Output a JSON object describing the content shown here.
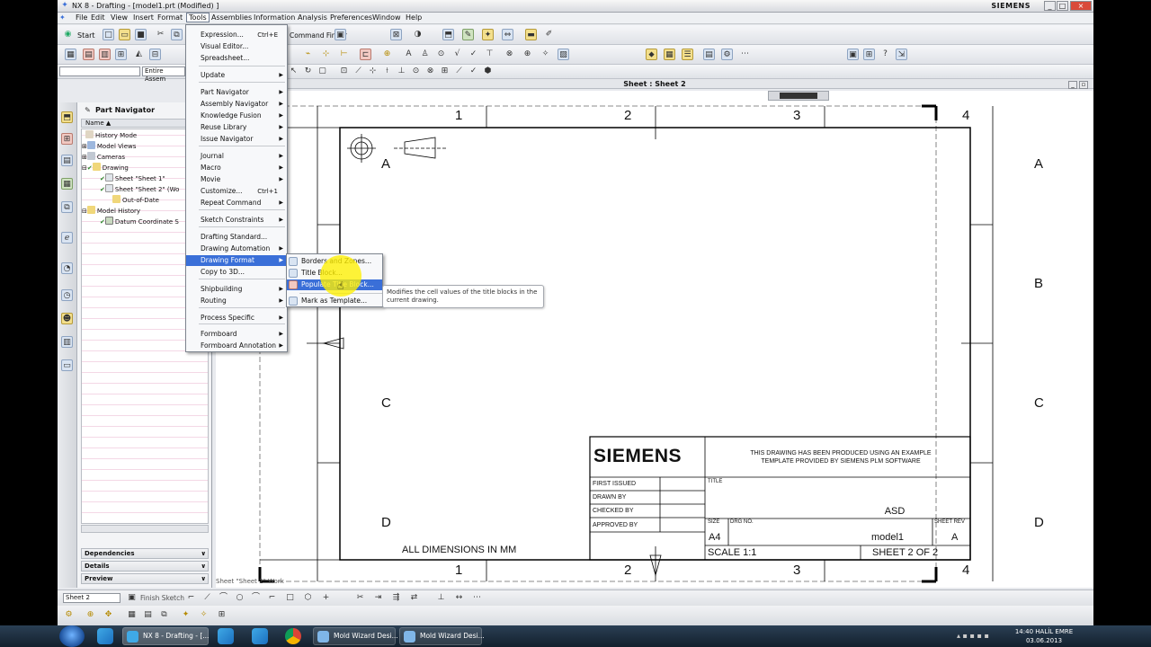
{
  "window": {
    "title": "NX 8 - Drafting - [model1.prt (Modified) ]",
    "brand": "SIEMENS",
    "controls": [
      "_",
      "□",
      "×"
    ]
  },
  "menubar": [
    "File",
    "Edit",
    "View",
    "Insert",
    "Format",
    "Tools",
    "Assemblies",
    "Information",
    "Analysis",
    "Preferences",
    "Window",
    "Help"
  ],
  "toolbar": {
    "start_label": "Start",
    "command_finder": "Command Finder",
    "selection_filter": "",
    "assembly_scope": "Entire Assem"
  },
  "sheet_bar": "Sheet : Sheet 2",
  "part_navigator": {
    "title": "Part Navigator",
    "column": "Name",
    "items": [
      {
        "label": "History Mode",
        "indent": 1
      },
      {
        "label": "Model Views",
        "indent": 1
      },
      {
        "label": "Cameras",
        "indent": 1
      },
      {
        "label": "Drawing",
        "indent": 1
      },
      {
        "label": "Sheet \"Sheet 1\"",
        "indent": 2
      },
      {
        "label": "Sheet \"Sheet 2\" (Wo",
        "indent": 2
      },
      {
        "label": "Out-of-Date",
        "indent": 3
      },
      {
        "label": "Model History",
        "indent": 1
      },
      {
        "label": "Datum Coordinate S",
        "indent": 2
      }
    ],
    "sections": [
      "Dependencies",
      "Details",
      "Preview"
    ]
  },
  "tools_menu": {
    "items": [
      {
        "label": "Expression...",
        "shortcut": "Ctrl+E",
        "sub": false
      },
      {
        "label": "Visual Editor...",
        "shortcut": "",
        "sub": false
      },
      {
        "label": "Spreadsheet...",
        "shortcut": "",
        "sub": false
      },
      {
        "label": "Update",
        "shortcut": "",
        "sub": true
      },
      {
        "label": "Part Navigator",
        "shortcut": "",
        "sub": true
      },
      {
        "label": "Assembly Navigator",
        "shortcut": "",
        "sub": true
      },
      {
        "label": "Knowledge Fusion",
        "shortcut": "",
        "sub": true
      },
      {
        "label": "Reuse Library",
        "shortcut": "",
        "sub": true
      },
      {
        "label": "Issue Navigator",
        "shortcut": "",
        "sub": true
      },
      {
        "label": "Journal",
        "shortcut": "",
        "sub": true
      },
      {
        "label": "Macro",
        "shortcut": "",
        "sub": true
      },
      {
        "label": "Movie",
        "shortcut": "",
        "sub": true
      },
      {
        "label": "Customize...",
        "shortcut": "Ctrl+1",
        "sub": false
      },
      {
        "label": "Repeat Command",
        "shortcut": "",
        "sub": true
      },
      {
        "label": "Sketch Constraints",
        "shortcut": "",
        "sub": true
      },
      {
        "label": "Drafting Standard...",
        "shortcut": "",
        "sub": false
      },
      {
        "label": "Drawing Automation",
        "shortcut": "",
        "sub": true
      },
      {
        "label": "Drawing Format",
        "shortcut": "",
        "sub": true
      },
      {
        "label": "Copy to 3D...",
        "shortcut": "",
        "sub": false
      },
      {
        "label": "Shipbuilding",
        "shortcut": "",
        "sub": true
      },
      {
        "label": "Routing",
        "shortcut": "",
        "sub": true
      },
      {
        "label": "Process Specific",
        "shortcut": "",
        "sub": true
      },
      {
        "label": "Formboard",
        "shortcut": "",
        "sub": true
      },
      {
        "label": "Formboard Annotation",
        "shortcut": "",
        "sub": true
      }
    ]
  },
  "drawing_format_menu": [
    "Borders and Zones...",
    "Title Block...",
    "Populate Title Block...",
    "Mark as Template..."
  ],
  "tooltip": "Modifies the cell values of the title blocks in the current drawing.",
  "drawing": {
    "columns": [
      "1",
      "2",
      "3",
      "4"
    ],
    "rows": [
      "A",
      "B",
      "C",
      "D"
    ],
    "note": "ALL DIMENSIONS IN MM",
    "company": "SIEMENS",
    "disclaimer_line1": "THIS DRAWING HAS BEEN PRODUCED USING AN EXAMPLE",
    "disclaimer_line2": "TEMPLATE PROVIDED BY SIEMENS PLM SOFTWARE",
    "first_issued": "FIRST ISSUED",
    "drawn_by": "DRAWN BY",
    "checked_by": "CHECKED BY",
    "approved_by": "APPROVED BY",
    "title_label": "TITLE",
    "title_value": "ASD",
    "size_label": "SIZE",
    "size_value": "A4",
    "drg_label": "DRG NO.",
    "drg_value": "model1",
    "rev_label": "SHEET REV",
    "rev_value": "A",
    "scale": "SCALE 1:1",
    "sheet": "SHEET 2 OF 2"
  },
  "status_text": "Sheet \"Sheet 2\" Work",
  "bottom_toolbar": {
    "sheet_select": "Sheet 2",
    "finish_sketch": "Finish Sketch"
  },
  "taskbar": {
    "tasks": [
      "NX 8 - Drafting - [...",
      "Mold Wizard Desi...",
      "Mold Wizard Desi..."
    ],
    "user": "HALİL EMRE",
    "time": "14:40",
    "date": "03.06.2013"
  },
  "colors": {
    "menu_highlight": "#3a6fd8",
    "tooltip_highlight": "#fff000",
    "nav_stripe": "#f4d8e6"
  }
}
